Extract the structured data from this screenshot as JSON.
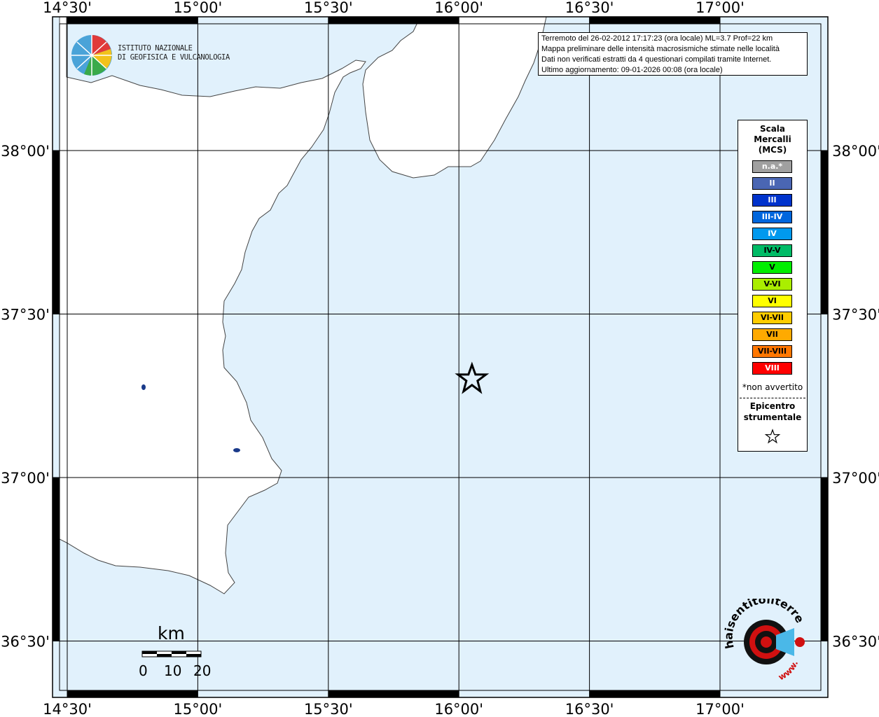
{
  "map": {
    "x_labels": [
      "14°30'",
      "15°00'",
      "15°30'",
      "16°00'",
      "16°30'",
      "17°00'"
    ],
    "y_labels": [
      "38°00'",
      "37°30'",
      "37°00'",
      "36°30'"
    ],
    "sea_color": "#e1f1fc",
    "land_color": "#ffffff",
    "lake_color": "#1a3a8a",
    "epicenter": {
      "lon": 16.05,
      "lat": 37.3
    }
  },
  "info": {
    "line1": "Terremoto del 26-02-2012 17:17:23 (ora locale) ML=3.7 Prof=22 km",
    "line2": "Mappa preliminare delle intensità macrosismiche stimate nelle località",
    "line3": "Dati non verificati estratti da 4 questionari compilati tramite Internet.",
    "line4": "Ultimo aggiornamento: 09-01-2026 00:08 (ora locale)"
  },
  "logo": {
    "ingv_text": "ISTITUTO NAZIONALE\nDI GEOFISICA E VULCANOLOGIA",
    "hst_text": "haisentitoilterremoto.it",
    "hst_www": "www."
  },
  "legend": {
    "title": "Scala\nMercalli\n(MCS)",
    "items": [
      {
        "label": "n.a.*",
        "color": "#a0a0a0",
        "text_color": "#ffffff"
      },
      {
        "label": "II",
        "color": "#4a66b3",
        "text_color": "#ffffff"
      },
      {
        "label": "III",
        "color": "#0033cc",
        "text_color": "#ffffff"
      },
      {
        "label": "III-IV",
        "color": "#0066dd",
        "text_color": "#ffffff"
      },
      {
        "label": "IV",
        "color": "#0099ee",
        "text_color": "#ffffff"
      },
      {
        "label": "IV-V",
        "color": "#00bb66",
        "text_color": "#000000"
      },
      {
        "label": "V",
        "color": "#00ee00",
        "text_color": "#000000"
      },
      {
        "label": "V-VI",
        "color": "#aaee00",
        "text_color": "#000000"
      },
      {
        "label": "VI",
        "color": "#ffff00",
        "text_color": "#000000"
      },
      {
        "label": "VI-VII",
        "color": "#ffcc00",
        "text_color": "#000000"
      },
      {
        "label": "VII",
        "color": "#ffaa00",
        "text_color": "#000000"
      },
      {
        "label": "VII-VIII",
        "color": "#ff7700",
        "text_color": "#000000"
      },
      {
        "label": "VIII",
        "color": "#ff0000",
        "text_color": "#ffffff"
      }
    ],
    "note": "*non avvertito",
    "epicentre_label": "Epicentro\nstrumentale"
  },
  "scalebar": {
    "unit": "km",
    "ticks": [
      "0",
      "10",
      "20"
    ]
  }
}
